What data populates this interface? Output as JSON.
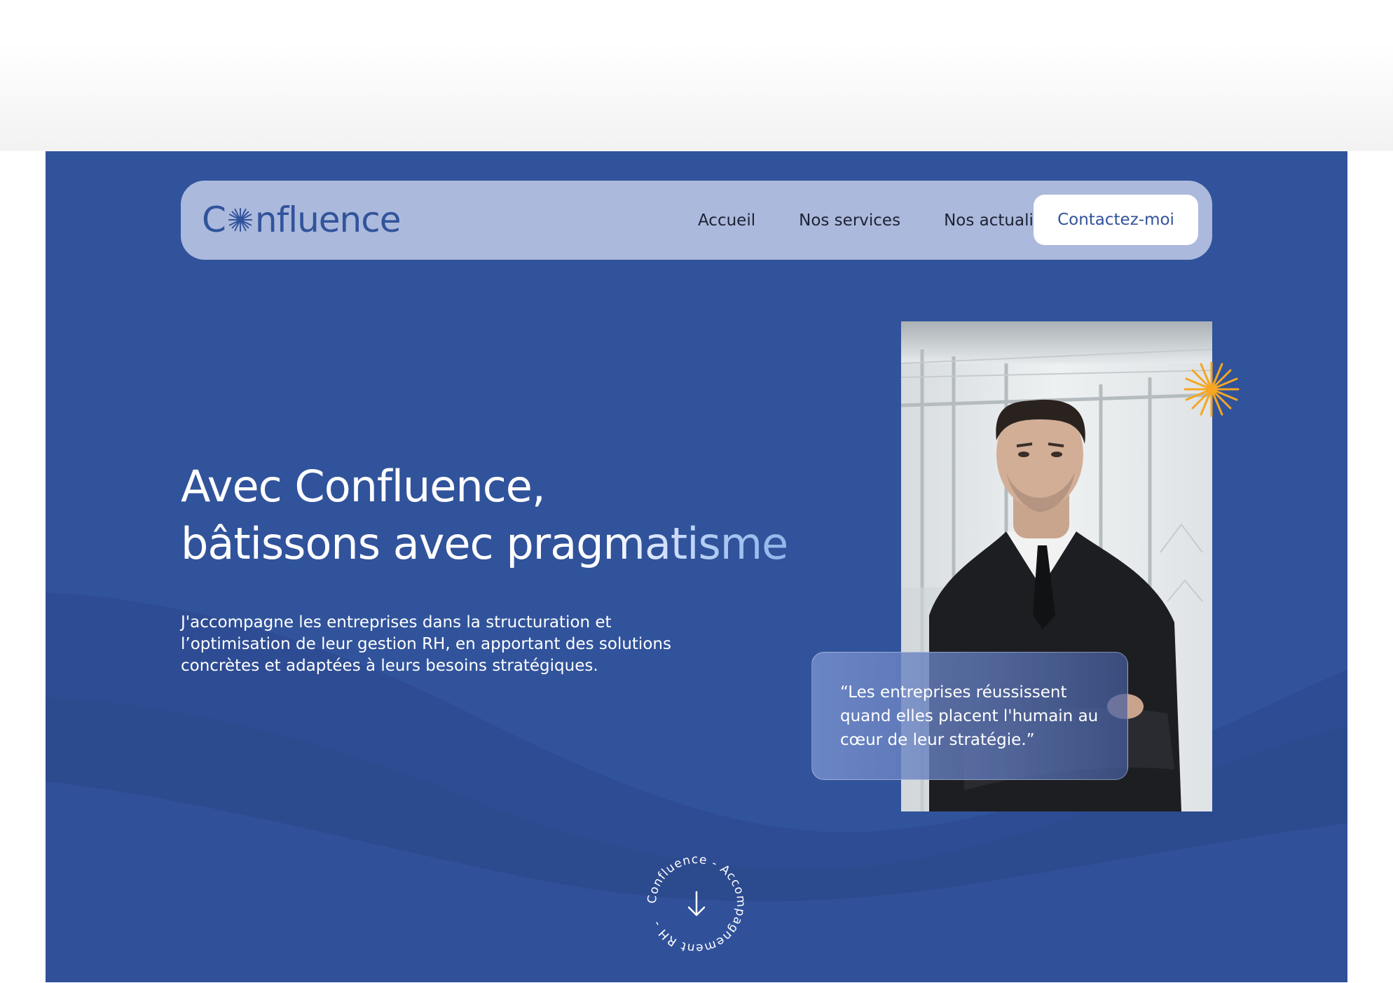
{
  "brand": {
    "name_part1": "C",
    "name_part2": "nfluence",
    "primary_color": "#31539b",
    "nav_bg_color": "#abb9dc",
    "accent_color": "#f5a623",
    "logo_icon": "sun-icon"
  },
  "nav": {
    "links": [
      {
        "label": "Accueil"
      },
      {
        "label": "Nos services"
      },
      {
        "label": "Nos actualités"
      }
    ],
    "cta_label": "Contactez-moi"
  },
  "hero": {
    "headline_line1": "Avec Confluence,",
    "headline_line2_plain": "bâtissons avec prag",
    "headline_line2_gradient": "matisme",
    "lead": "J'accompagne les entreprises dans la structuration et l’optimisation de leur gestion RH, en apportant des solutions concrètes et adaptées à leurs besoins stratégiques."
  },
  "quote": {
    "text": "“Les entreprises réussissent quand elles placent l'humain au cœur de leur stratégie.”"
  },
  "scroll": {
    "circle_text": "Confluence - Accompagnement RH - ",
    "icon": "arrow-down-icon"
  },
  "decor": {
    "star_icon": "starburst-icon"
  }
}
